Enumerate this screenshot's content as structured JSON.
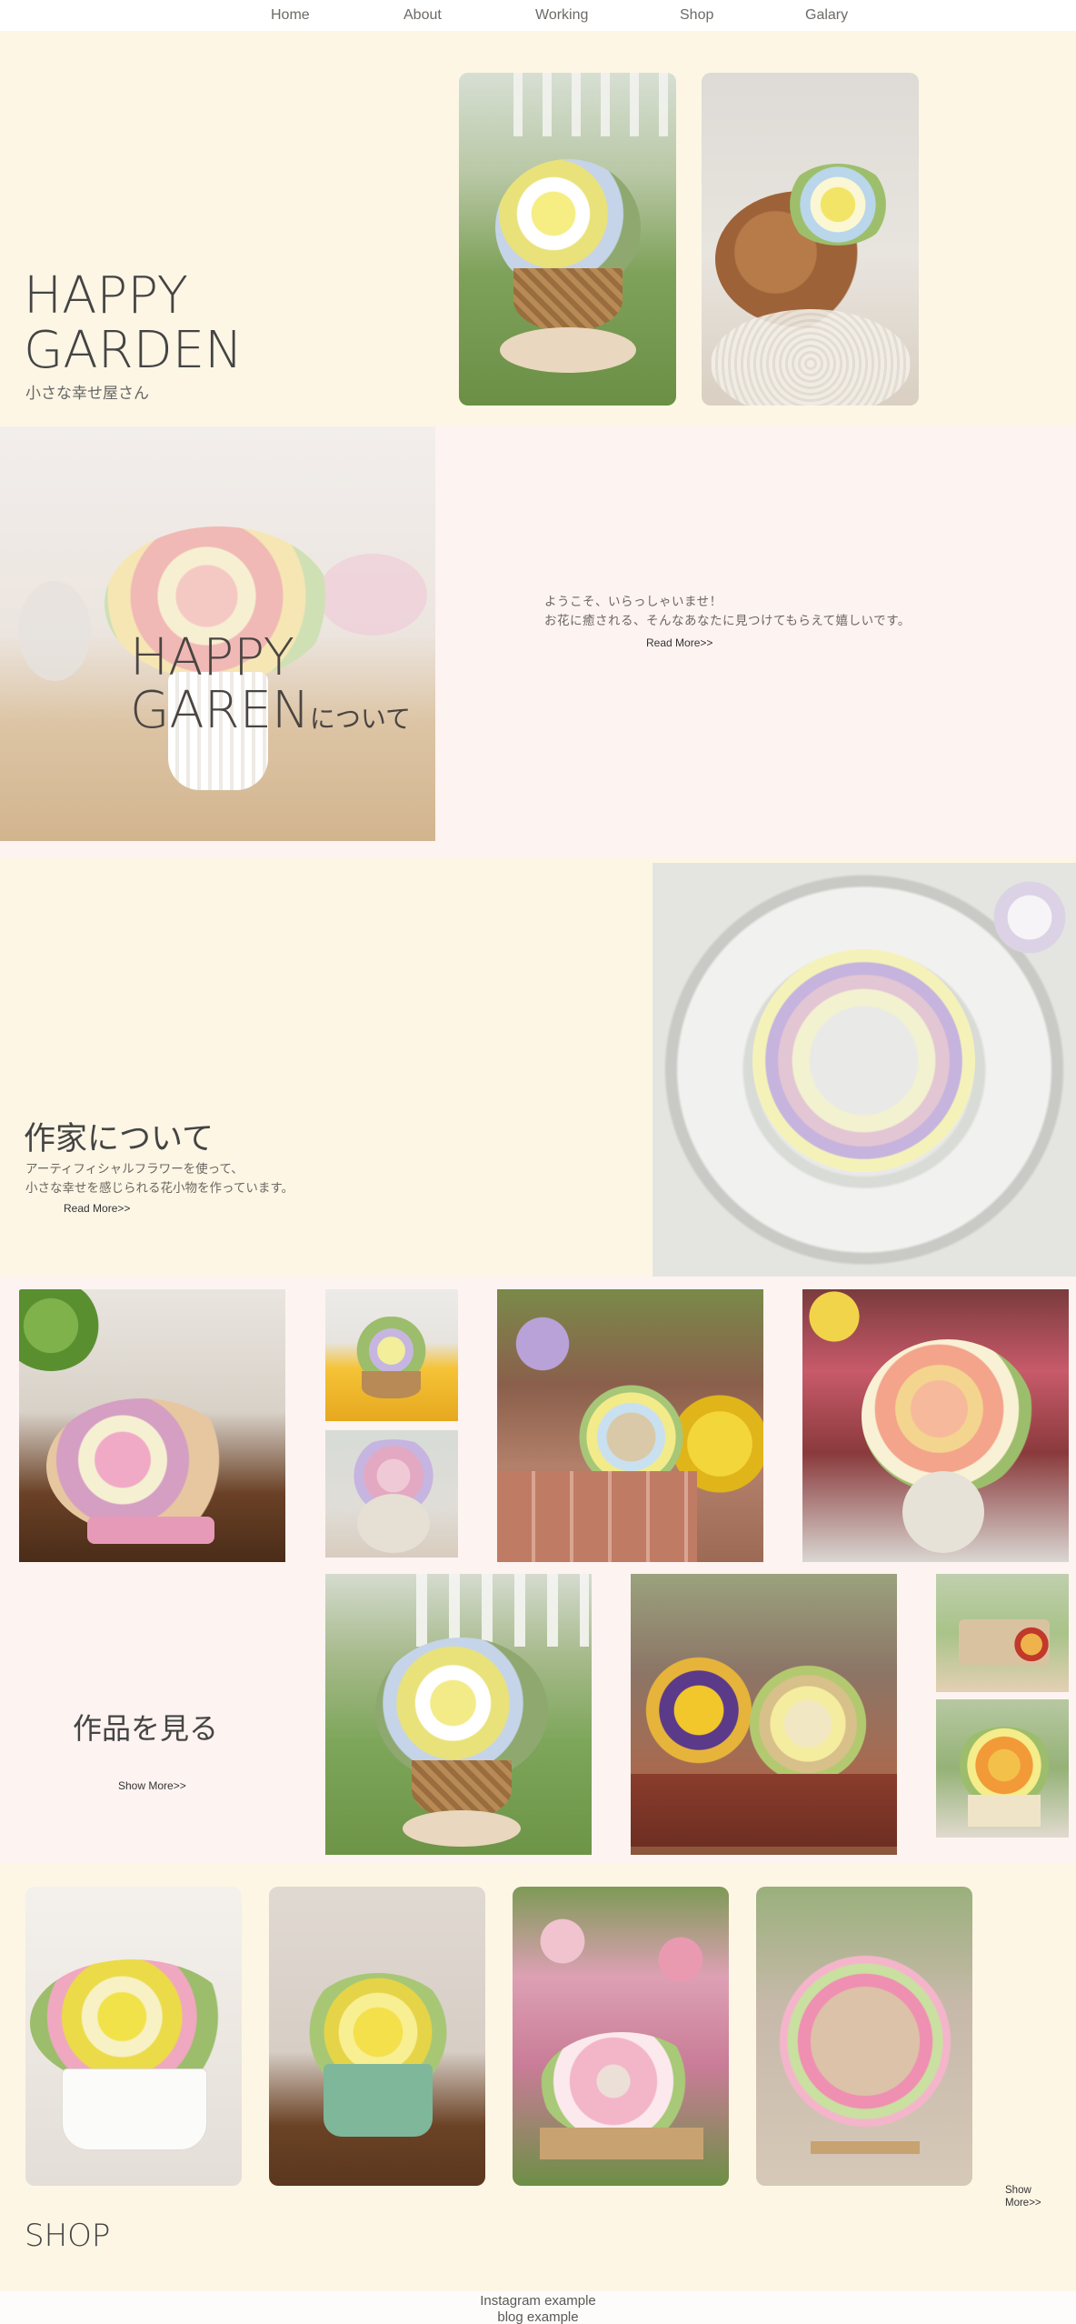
{
  "nav": {
    "items": [
      "Home",
      "About",
      "Working",
      "Shop",
      "Galary"
    ]
  },
  "hero": {
    "title_line1": "HAPPY",
    "title_line2": "GARDEN",
    "subtitle": "小さな幸せ屋さん"
  },
  "about": {
    "overlay_line1": "HAPPY",
    "overlay_line2": "GAREN",
    "overlay_suffix": "について",
    "welcome_line1": "ようこそ、いらっしゃいませ！",
    "welcome_line2": "お花に癒される、そんなあなたに見つけてもらえて嬉しいです。",
    "read_more": "Read More>>"
  },
  "artist": {
    "heading": "作家について",
    "text_line1": "アーティフィシャルフラワーを使って、",
    "text_line2": "小さな幸せを感じられる花小物を作っています。",
    "read_more": "Read More>>"
  },
  "works": {
    "heading": "作品を見る",
    "show_more": "Show More>>"
  },
  "shop": {
    "heading": "SHOP",
    "show_more_line1": "Show",
    "show_more_line2": "More>>"
  },
  "footer": {
    "line1": "Instagram example",
    "line2": "blog example"
  },
  "colors": {
    "cream": "#fdf6e5",
    "blush": "#fdf3f1",
    "text": "#4a4744"
  }
}
